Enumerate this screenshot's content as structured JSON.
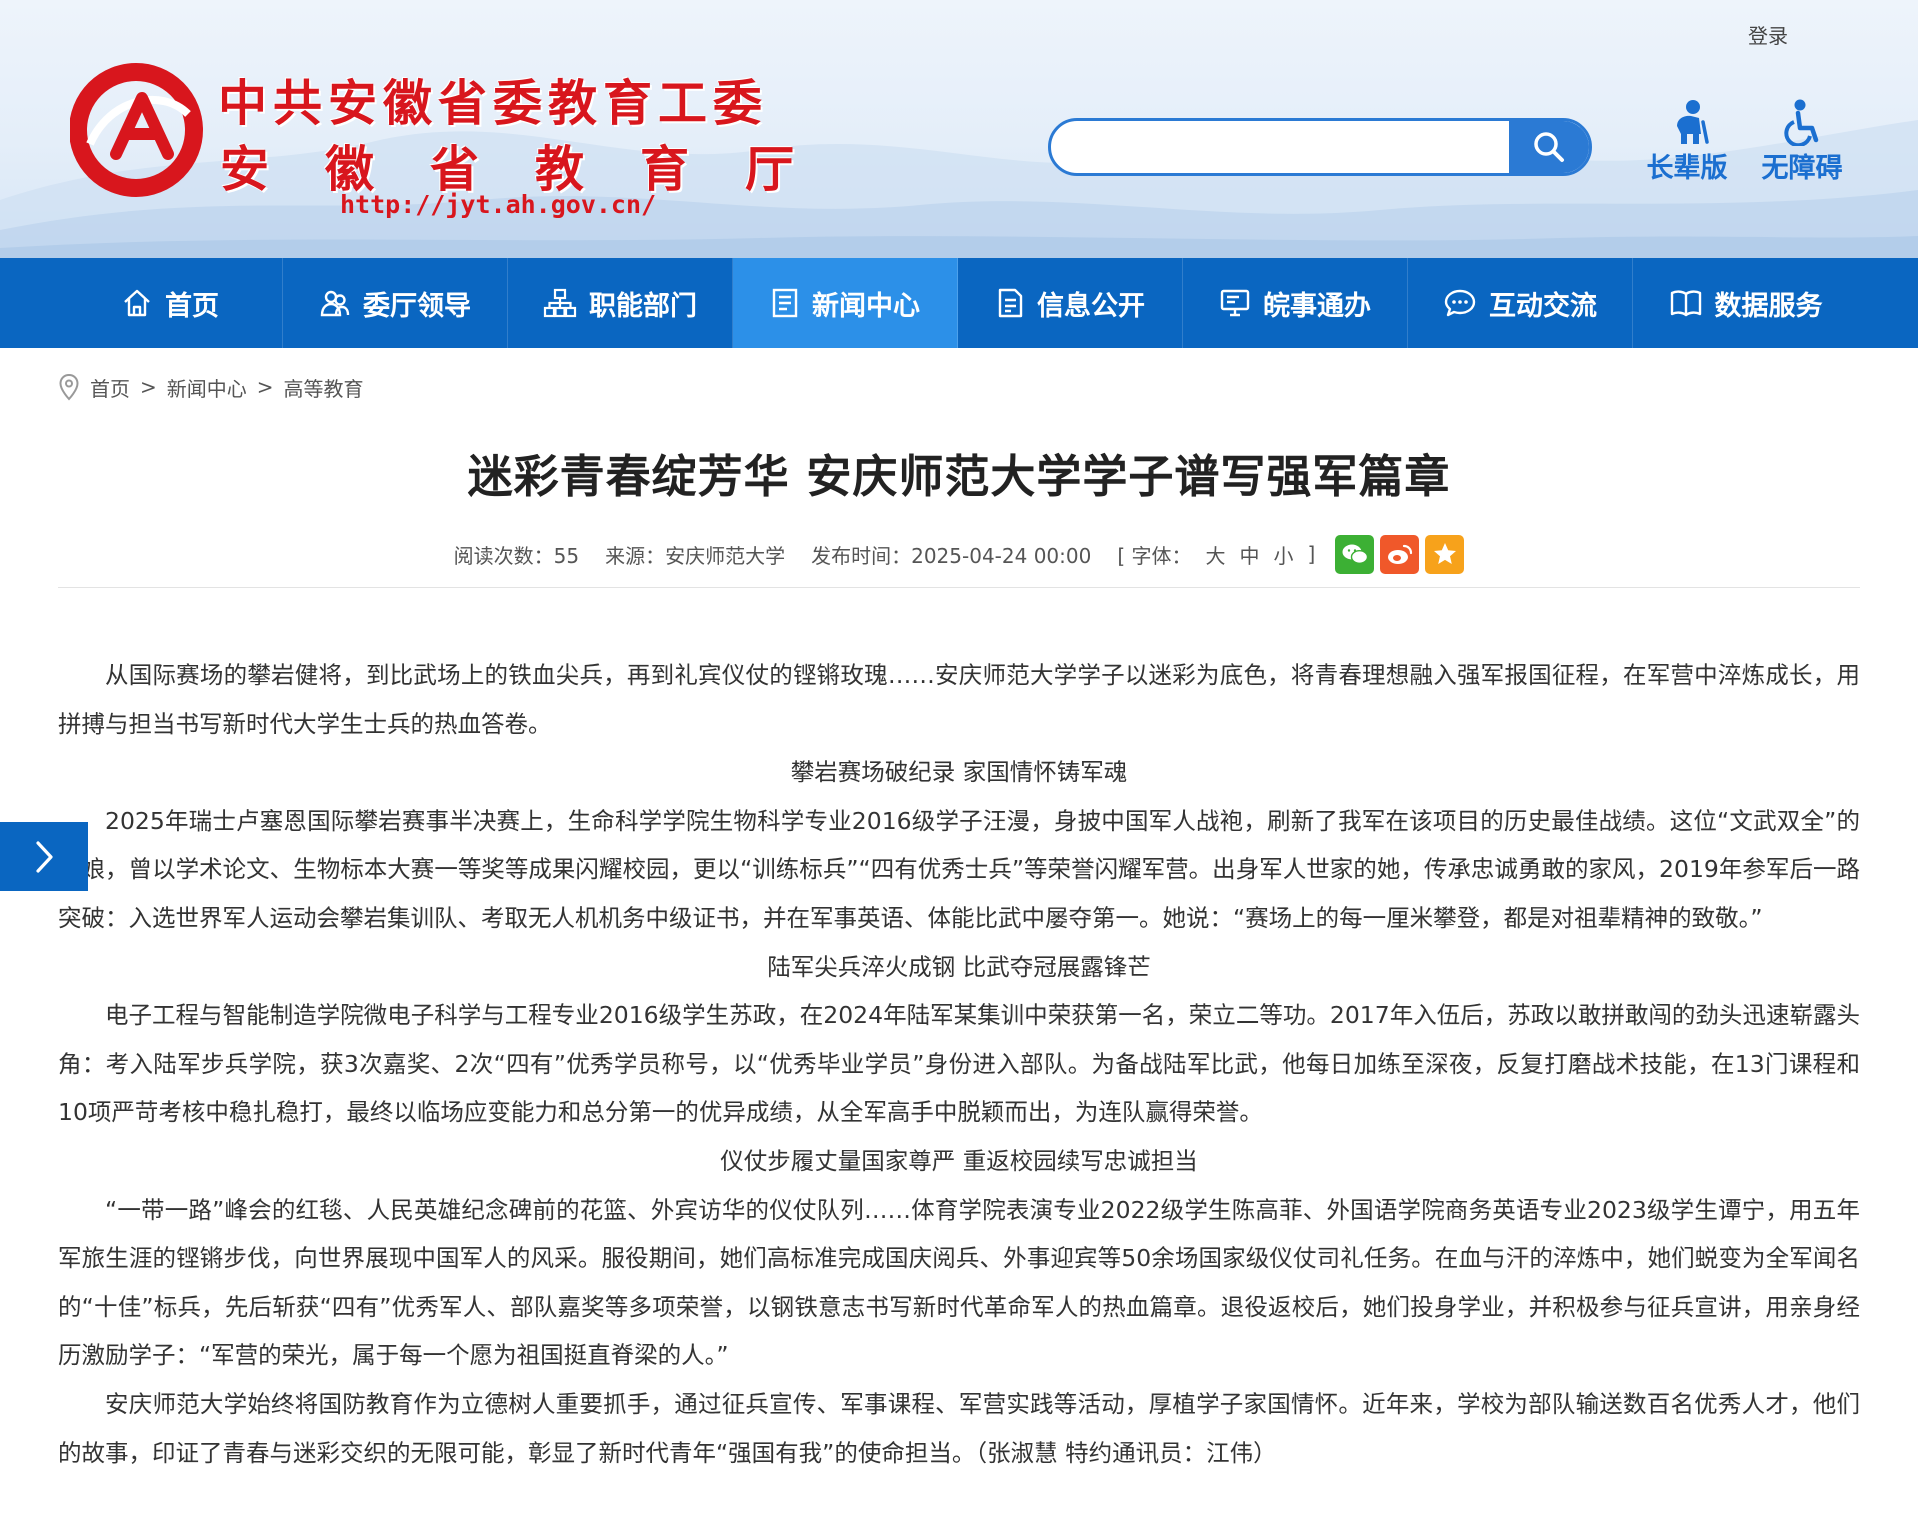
{
  "header": {
    "login_label": "登录",
    "org_name_1": "中共安徽省委教育工委",
    "org_name_2": "安徽省教育厅",
    "site_url": "http://jyt.ah.gov.cn/",
    "search_placeholder": "",
    "tools": [
      {
        "label": "长辈版",
        "icon": "elder-icon"
      },
      {
        "label": "无障碍",
        "icon": "wheelchair-icon"
      }
    ]
  },
  "nav": {
    "items": [
      {
        "label": "首页",
        "icon": "home-icon",
        "active": false
      },
      {
        "label": "委厅领导",
        "icon": "leaders-icon",
        "active": false
      },
      {
        "label": "职能部门",
        "icon": "org-chart-icon",
        "active": false
      },
      {
        "label": "新闻中心",
        "icon": "news-icon",
        "active": true
      },
      {
        "label": "信息公开",
        "icon": "document-icon",
        "active": false
      },
      {
        "label": "皖事通办",
        "icon": "monitor-icon",
        "active": false
      },
      {
        "label": "互动交流",
        "icon": "chat-icon",
        "active": false
      },
      {
        "label": "数据服务",
        "icon": "book-icon",
        "active": false
      }
    ]
  },
  "breadcrumb": {
    "items": [
      "首页",
      "新闻中心",
      "高等教育"
    ],
    "separator": ">"
  },
  "article": {
    "title": "迷彩青春绽芳华 安庆师范大学学子谱写强军篇章",
    "meta": {
      "views_label": "阅读次数：",
      "views": "55",
      "source_label": "来源：",
      "source": "安庆师范大学",
      "date_label": "发布时间：",
      "date": "2025-04-24 00:00",
      "font_open": "[ 字体：",
      "font_large": "大",
      "font_medium": "中",
      "font_small": "小",
      "font_close": "]"
    },
    "paragraphs": [
      {
        "type": "p",
        "text": "从国际赛场的攀岩健将，到比武场上的铁血尖兵，再到礼宾仪仗的铿锵玫瑰……安庆师范大学学子以迷彩为底色，将青春理想融入强军报国征程，在军营中淬炼成长，用拼搏与担当书写新时代大学生士兵的热血答卷。"
      },
      {
        "type": "h",
        "text": "攀岩赛场破纪录 家国情怀铸军魂"
      },
      {
        "type": "p",
        "text": "2025年瑞士卢塞恩国际攀岩赛事半决赛上，生命科学学院生物科学专业2016级学子汪漫，身披中国军人战袍，刷新了我军在该项目的历史最佳战绩。这位“文武双全”的姑娘，曾以学术论文、生物标本大赛一等奖等成果闪耀校园，更以“训练标兵”“四有优秀士兵”等荣誉闪耀军营。出身军人世家的她，传承忠诚勇敢的家风，2019年参军后一路突破：入选世界军人运动会攀岩集训队、考取无人机机务中级证书，并在军事英语、体能比武中屡夺第一。她说：“赛场上的每一厘米攀登，都是对祖辈精神的致敬。”"
      },
      {
        "type": "h",
        "text": "陆军尖兵淬火成钢 比武夺冠展露锋芒"
      },
      {
        "type": "p",
        "text": "电子工程与智能制造学院微电子科学与工程专业2016级学生苏政，在2024年陆军某集训中荣获第一名，荣立二等功。2017年入伍后，苏政以敢拼敢闯的劲头迅速崭露头角：考入陆军步兵学院，获3次嘉奖、2次“四有”优秀学员称号，以“优秀毕业学员”身份进入部队。为备战陆军比武，他每日加练至深夜，反复打磨战术技能，在13门课程和10项严苛考核中稳扎稳打，最终以临场应变能力和总分第一的优异成绩，从全军高手中脱颖而出，为连队赢得荣誉。"
      },
      {
        "type": "h",
        "text": "仪仗步履丈量国家尊严 重返校园续写忠诚担当"
      },
      {
        "type": "p",
        "text": "“一带一路”峰会的红毯、人民英雄纪念碑前的花篮、外宾访华的仪仗队列……体育学院表演专业2022级学生陈高菲、外国语学院商务英语专业2023级学生谭宁，用五年军旅生涯的铿锵步伐，向世界展现中国军人的风采。服役期间，她们高标准完成国庆阅兵、外事迎宾等50余场国家级仪仗司礼任务。在血与汗的淬炼中，她们蜕变为全军闻名的“十佳”标兵，先后斩获“四有”优秀军人、部队嘉奖等多项荣誉，以钢铁意志书写新时代革命军人的热血篇章。退役返校后，她们投身学业，并积极参与征兵宣讲，用亲身经历激励学子：“军营的荣光，属于每一个愿为祖国挺直脊梁的人。”"
      },
      {
        "type": "p",
        "text": "安庆师范大学始终将国防教育作为立德树人重要抓手，通过征兵宣传、军事课程、军营实践等活动，厚植学子家国情怀。近年来，学校为部队输送数百名优秀人才，他们的故事，印证了青春与迷彩交织的无限可能，彰显了新时代青年“强国有我”的使命担当。（张淑慧 特约通讯员：江伟）"
      }
    ]
  },
  "colors": {
    "brand_red": "#d8161d",
    "nav_blue": "#0a66c1",
    "nav_active": "#2c90e8",
    "tool_blue": "#1b6fd0"
  }
}
